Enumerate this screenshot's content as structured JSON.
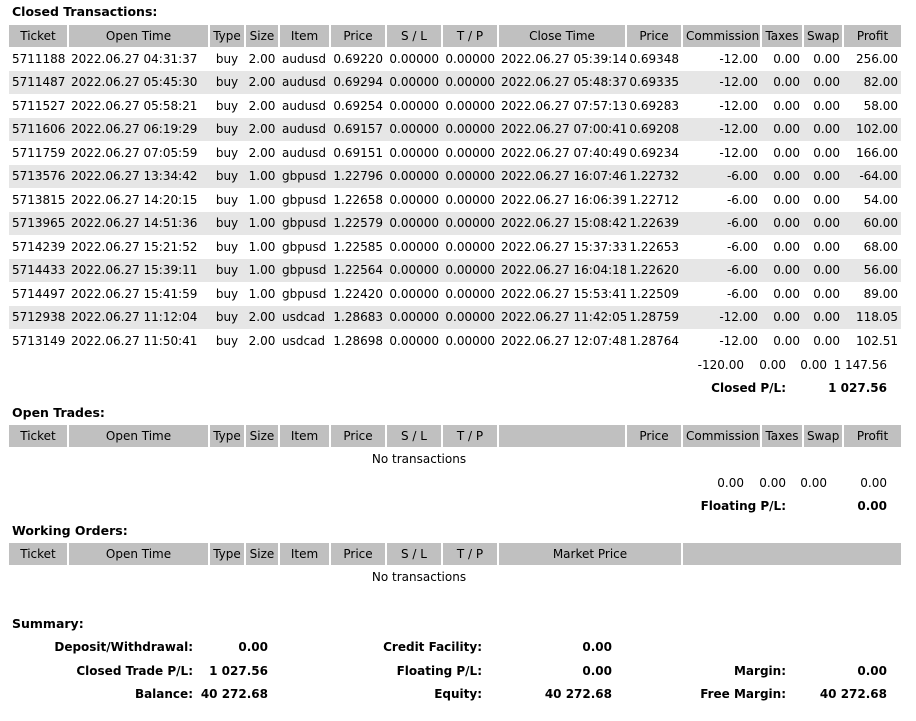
{
  "closed": {
    "title": "Closed Transactions:",
    "headers": [
      "Ticket",
      "Open Time",
      "Type",
      "Size",
      "Item",
      "Price",
      "S / L",
      "T / P",
      "Close Time",
      "Price",
      "Commission",
      "Taxes",
      "Swap",
      "Profit"
    ],
    "rows": [
      [
        "5711188",
        "2022.06.27 04:31:37",
        "buy",
        "2.00",
        "audusd",
        "0.69220",
        "0.00000",
        "0.00000",
        "2022.06.27 05:39:14",
        "0.69348",
        "-12.00",
        "0.00",
        "0.00",
        "256.00"
      ],
      [
        "5711487",
        "2022.06.27 05:45:30",
        "buy",
        "2.00",
        "audusd",
        "0.69294",
        "0.00000",
        "0.00000",
        "2022.06.27 05:48:37",
        "0.69335",
        "-12.00",
        "0.00",
        "0.00",
        "82.00"
      ],
      [
        "5711527",
        "2022.06.27 05:58:21",
        "buy",
        "2.00",
        "audusd",
        "0.69254",
        "0.00000",
        "0.00000",
        "2022.06.27 07:57:13",
        "0.69283",
        "-12.00",
        "0.00",
        "0.00",
        "58.00"
      ],
      [
        "5711606",
        "2022.06.27 06:19:29",
        "buy",
        "2.00",
        "audusd",
        "0.69157",
        "0.00000",
        "0.00000",
        "2022.06.27 07:00:41",
        "0.69208",
        "-12.00",
        "0.00",
        "0.00",
        "102.00"
      ],
      [
        "5711759",
        "2022.06.27 07:05:59",
        "buy",
        "2.00",
        "audusd",
        "0.69151",
        "0.00000",
        "0.00000",
        "2022.06.27 07:40:49",
        "0.69234",
        "-12.00",
        "0.00",
        "0.00",
        "166.00"
      ],
      [
        "5713576",
        "2022.06.27 13:34:42",
        "buy",
        "1.00",
        "gbpusd",
        "1.22796",
        "0.00000",
        "0.00000",
        "2022.06.27 16:07:46",
        "1.22732",
        "-6.00",
        "0.00",
        "0.00",
        "-64.00"
      ],
      [
        "5713815",
        "2022.06.27 14:20:15",
        "buy",
        "1.00",
        "gbpusd",
        "1.22658",
        "0.00000",
        "0.00000",
        "2022.06.27 16:06:39",
        "1.22712",
        "-6.00",
        "0.00",
        "0.00",
        "54.00"
      ],
      [
        "5713965",
        "2022.06.27 14:51:36",
        "buy",
        "1.00",
        "gbpusd",
        "1.22579",
        "0.00000",
        "0.00000",
        "2022.06.27 15:08:42",
        "1.22639",
        "-6.00",
        "0.00",
        "0.00",
        "60.00"
      ],
      [
        "5714239",
        "2022.06.27 15:21:52",
        "buy",
        "1.00",
        "gbpusd",
        "1.22585",
        "0.00000",
        "0.00000",
        "2022.06.27 15:37:33",
        "1.22653",
        "-6.00",
        "0.00",
        "0.00",
        "68.00"
      ],
      [
        "5714433",
        "2022.06.27 15:39:11",
        "buy",
        "1.00",
        "gbpusd",
        "1.22564",
        "0.00000",
        "0.00000",
        "2022.06.27 16:04:18",
        "1.22620",
        "-6.00",
        "0.00",
        "0.00",
        "56.00"
      ],
      [
        "5714497",
        "2022.06.27 15:41:59",
        "buy",
        "1.00",
        "gbpusd",
        "1.22420",
        "0.00000",
        "0.00000",
        "2022.06.27 15:53:41",
        "1.22509",
        "-6.00",
        "0.00",
        "0.00",
        "89.00"
      ],
      [
        "5712938",
        "2022.06.27 11:12:04",
        "buy",
        "2.00",
        "usdcad",
        "1.28683",
        "0.00000",
        "0.00000",
        "2022.06.27 11:42:05",
        "1.28759",
        "-12.00",
        "0.00",
        "0.00",
        "118.05"
      ],
      [
        "5713149",
        "2022.06.27 11:50:41",
        "buy",
        "2.00",
        "usdcad",
        "1.28698",
        "0.00000",
        "0.00000",
        "2022.06.27 12:07:48",
        "1.28764",
        "-12.00",
        "0.00",
        "0.00",
        "102.51"
      ]
    ],
    "totals": {
      "commission": "-120.00",
      "taxes": "0.00",
      "swap": "0.00",
      "profit": "1 147.56"
    },
    "pl_label": "Closed P/L:",
    "pl_value": "1 027.56"
  },
  "open": {
    "title": "Open Trades:",
    "headers": [
      "Ticket",
      "Open Time",
      "Type",
      "Size",
      "Item",
      "Price",
      "S / L",
      "T / P",
      "",
      "Price",
      "Commission",
      "Taxes",
      "Swap",
      "Profit"
    ],
    "empty": "No transactions",
    "totals": {
      "commission": "0.00",
      "taxes": "0.00",
      "swap": "0.00",
      "profit": "0.00"
    },
    "pl_label": "Floating P/L:",
    "pl_value": "0.00"
  },
  "working": {
    "title": "Working Orders:",
    "headers": [
      "Ticket",
      "Open Time",
      "Type",
      "Size",
      "Item",
      "Price",
      "S / L",
      "T / P",
      "Market Price",
      ""
    ],
    "empty": "No transactions"
  },
  "summary": {
    "title": "Summary:",
    "deposit_label": "Deposit/Withdrawal:",
    "deposit_value": "0.00",
    "credit_label": "Credit Facility:",
    "credit_value": "0.00",
    "closed_label": "Closed Trade P/L:",
    "closed_value": "1 027.56",
    "floating_label": "Floating P/L:",
    "floating_value": "0.00",
    "margin_label": "Margin:",
    "margin_value": "0.00",
    "balance_label": "Balance:",
    "balance_value": "40 272.68",
    "equity_label": "Equity:",
    "equity_value": "40 272.68",
    "free_margin_label": "Free Margin:",
    "free_margin_value": "40 272.68"
  }
}
